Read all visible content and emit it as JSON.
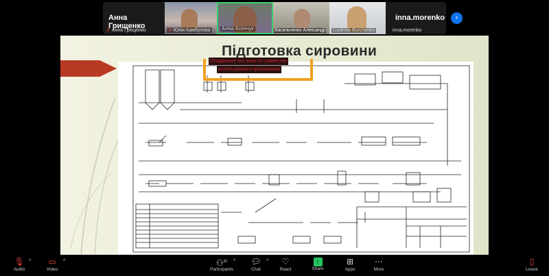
{
  "participants": [
    {
      "name": "Анна Грищенко",
      "label": "Анна Грищенко",
      "video": false,
      "muted": true
    },
    {
      "name": "Юлія Камбулова",
      "label": "Юлія Камбулова",
      "video": true,
      "muted": true
    },
    {
      "name": "Аліна Єсенчук",
      "label": "Аліна Єсенчук",
      "video": true,
      "muted": false,
      "speaking": true
    },
    {
      "name": "Васильченко Александр",
      "label": "Васильченко Александр",
      "video": true,
      "muted": false
    },
    {
      "name": "Liudmila Burchenko",
      "label": "Liudmila Burchenko",
      "video": true,
      "muted": false
    },
    {
      "name": "inna.morenko",
      "label": "inna.morenko",
      "video": false,
      "muted": false
    }
  ],
  "slide": {
    "title": "Підготовка сировини"
  },
  "warning": {
    "line1": "Отодвиньте это окно от совместно",
    "line2": "используемого приложения"
  },
  "toolbar": {
    "audio": "Audio",
    "video": "Video",
    "participants": "Participants",
    "participants_count": "20",
    "chat": "Chat",
    "react": "React",
    "share": "Share",
    "apps": "Apps",
    "more": "More",
    "leave": "Leave"
  },
  "colors": {
    "accent": "#0e72ed",
    "share": "#22c55e",
    "speaking": "#3ccf6e",
    "leave": "#e0413a"
  }
}
